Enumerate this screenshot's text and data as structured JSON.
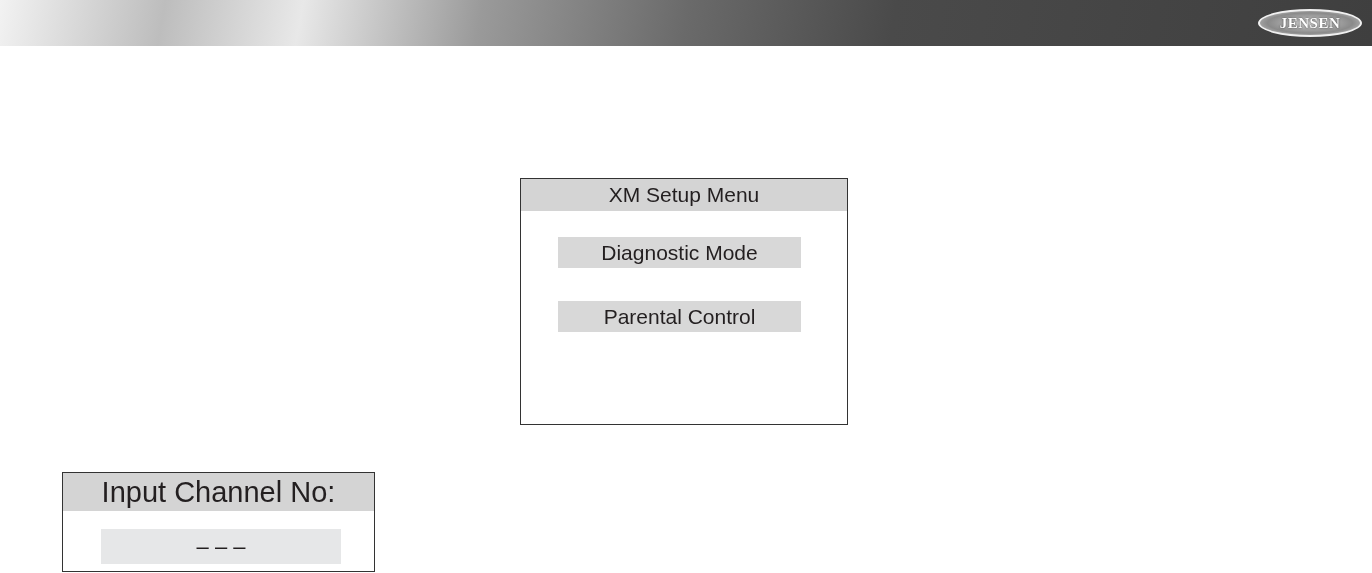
{
  "header": {
    "logo": "JENSEN"
  },
  "setup_menu": {
    "title": "XM Setup Menu",
    "items": [
      {
        "label": "Diagnostic Mode"
      },
      {
        "label": "Parental Control"
      }
    ]
  },
  "channel_input": {
    "title": "Input Channel No:",
    "value": "– – –"
  }
}
